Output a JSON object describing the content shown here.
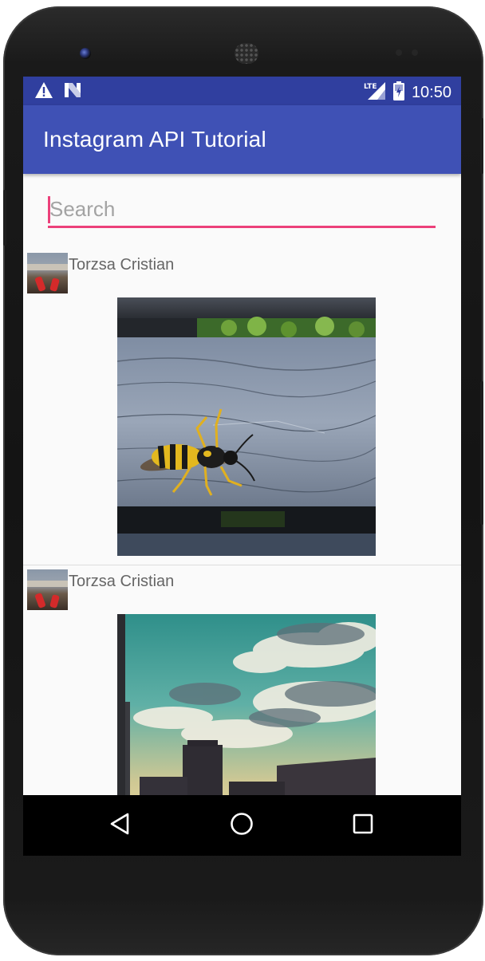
{
  "status_bar": {
    "time": "10:50",
    "network_label": "LTE",
    "icons": [
      "warning-icon",
      "n-notification-icon",
      "lte-signal-icon",
      "battery-icon"
    ]
  },
  "app_bar": {
    "title": "Instagram API Tutorial"
  },
  "search": {
    "placeholder": "Search",
    "value": ""
  },
  "feed": {
    "items": [
      {
        "username": "Torzsa Cristian",
        "image_subject": "wasp on weathered wooden plank"
      },
      {
        "username": "Torzsa Cristian",
        "image_subject": "sky with clouds over city buildings"
      }
    ]
  },
  "nav_bar": {
    "buttons": [
      "back-icon",
      "home-icon",
      "recents-icon"
    ]
  },
  "colors": {
    "status_bar": "#303f9f",
    "app_bar": "#3f51b5",
    "accent": "#ec407a",
    "screen_bg": "#fafafa",
    "username_text": "#666666",
    "placeholder_text": "#a3a3a3"
  }
}
